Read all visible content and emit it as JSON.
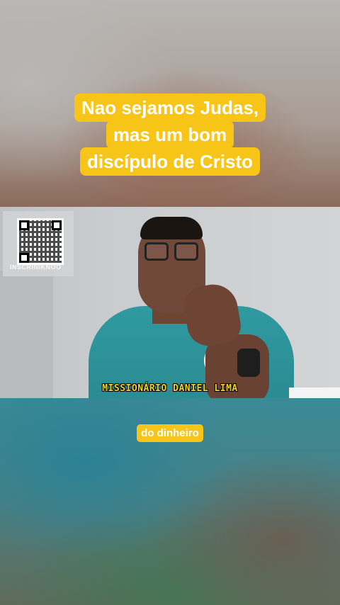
{
  "caption": {
    "line1": "Nao sejamos Judas,",
    "line2": "mas um bom",
    "line3": "discípulo de Cristo"
  },
  "video": {
    "qr_label": "INSCRINIKNOO",
    "name_tag": "MISSIONÁRIO DANIEL LIMA"
  },
  "subtitle": {
    "text": "do dinheiro"
  },
  "colors": {
    "caption_bg": "#f7c418",
    "name_tag": "#f3d21d"
  }
}
